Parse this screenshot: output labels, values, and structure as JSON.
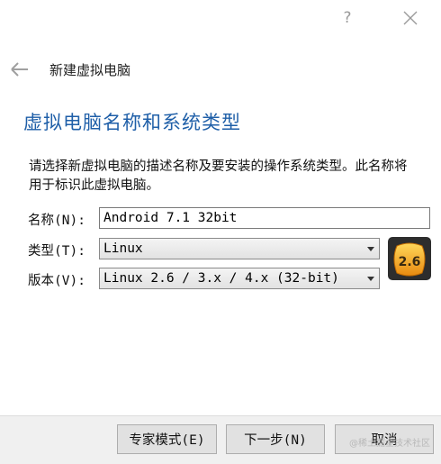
{
  "titlebar": {
    "help_icon_glyph": "?"
  },
  "header": {
    "title": "新建虚拟电脑"
  },
  "page": {
    "heading": "虚拟电脑名称和系统类型",
    "description": "请选择新虚拟电脑的描述名称及要安装的操作系统类型。此名称将用于标识此虚拟电脑。"
  },
  "form": {
    "name_label": "名称(N):",
    "name_value": "Android 7.1 32bit",
    "type_label": "类型(T):",
    "type_value": "Linux",
    "version_label": "版本(V):",
    "version_value": "Linux 2.6 / 3.x / 4.x (32-bit)",
    "os_badge": "2.6"
  },
  "buttons": {
    "expert": "专家模式(E)",
    "next": "下一步(N)",
    "cancel": "取消"
  },
  "watermark": "@稀土掘金技术社区",
  "colors": {
    "heading": "#1f5fa8",
    "badge_fill": "#f0a020"
  },
  "icons": {
    "back": "arrow-left-icon",
    "close": "close-icon",
    "help": "help-icon",
    "os": "linux-os-icon"
  }
}
